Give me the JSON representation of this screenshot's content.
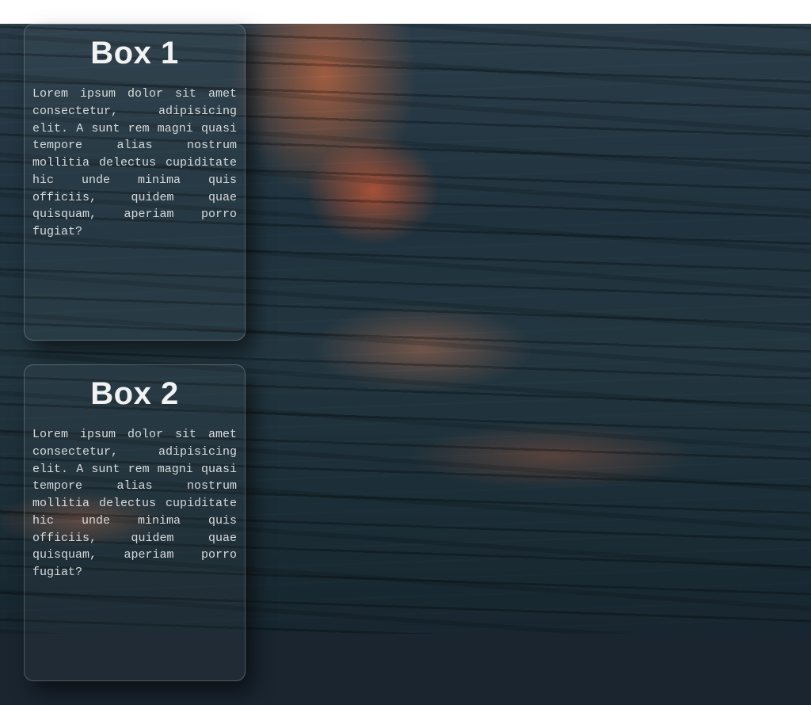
{
  "boxes": [
    {
      "title": "Box 1",
      "body": "Lorem ipsum dolor sit amet consectetur, adipisicing elit. A sunt rem magni quasi tempore alias nostrum mollitia delectus cupiditate hic unde minima quis officiis, quidem quae quisquam, aperiam porro fugiat?"
    },
    {
      "title": "Box 2",
      "body": "Lorem ipsum dolor sit amet consectetur, adipisicing elit. A sunt rem magni quasi tempore alias nostrum mollitia delectus cupiditate hic unde minima quis officiis, quidem quae quisquam, aperiam porro fugiat?"
    }
  ]
}
